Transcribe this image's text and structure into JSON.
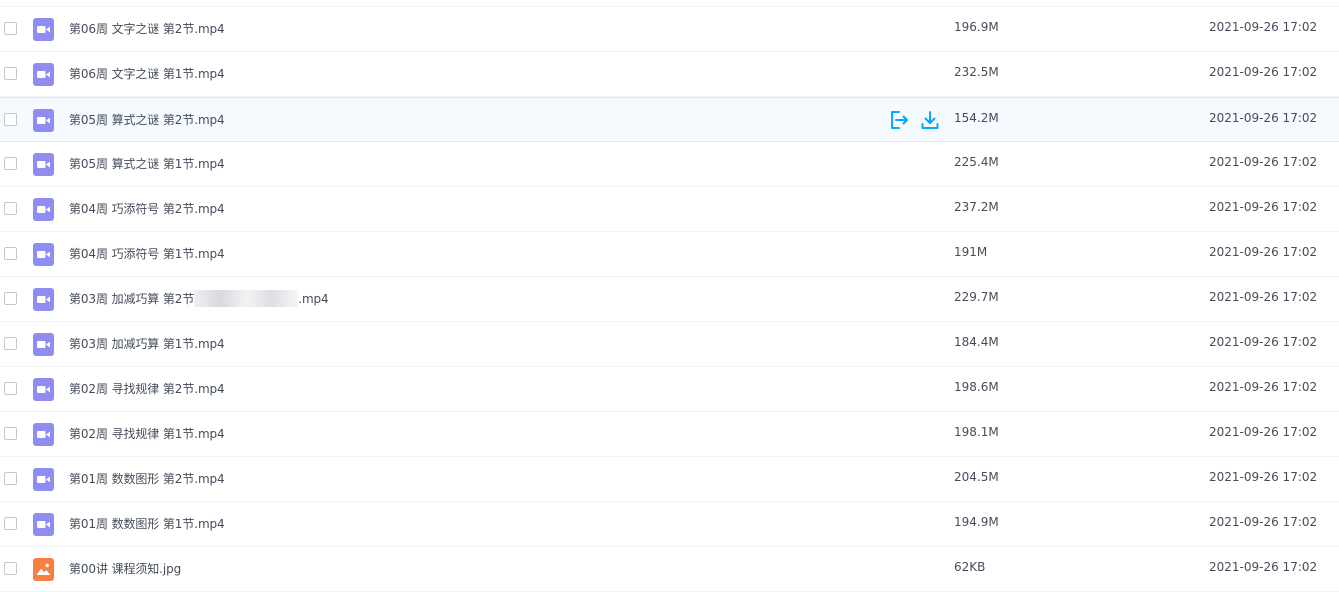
{
  "files": [
    {
      "name": "第06周 文字之谜 第2节.mp4",
      "size": "196.9M",
      "date": "2021-09-26 17:02",
      "type": "video",
      "icon": "video-file-icon"
    },
    {
      "name": "第06周 文字之谜 第1节.mp4",
      "size": "232.5M",
      "date": "2021-09-26 17:02",
      "type": "video",
      "icon": "video-file-icon"
    },
    {
      "name": "第05周 算式之谜 第2节.mp4",
      "size": "154.2M",
      "date": "2021-09-26 17:02",
      "type": "video",
      "icon": "video-file-icon",
      "hovered": true
    },
    {
      "name": "第05周 算式之谜 第1节.mp4",
      "size": "225.4M",
      "date": "2021-09-26 17:02",
      "type": "video",
      "icon": "video-file-icon"
    },
    {
      "name": "第04周 巧添符号 第2节.mp4",
      "size": "237.2M",
      "date": "2021-09-26 17:02",
      "type": "video",
      "icon": "video-file-icon"
    },
    {
      "name": "第04周 巧添符号 第1节.mp4",
      "size": "191M",
      "date": "2021-09-26 17:02",
      "type": "video",
      "icon": "video-file-icon"
    },
    {
      "name_prefix": "第03周 加减巧算 第2节",
      "name_suffix": ".mp4",
      "redacted": true,
      "size": "229.7M",
      "date": "2021-09-26 17:02",
      "type": "video",
      "icon": "video-file-icon"
    },
    {
      "name": "第03周 加减巧算 第1节.mp4",
      "size": "184.4M",
      "date": "2021-09-26 17:02",
      "type": "video",
      "icon": "video-file-icon"
    },
    {
      "name": "第02周 寻找规律 第2节.mp4",
      "size": "198.6M",
      "date": "2021-09-26 17:02",
      "type": "video",
      "icon": "video-file-icon"
    },
    {
      "name": "第02周 寻找规律 第1节.mp4",
      "size": "198.1M",
      "date": "2021-09-26 17:02",
      "type": "video",
      "icon": "video-file-icon"
    },
    {
      "name": "第01周 数数图形 第2节.mp4",
      "size": "204.5M",
      "date": "2021-09-26 17:02",
      "type": "video",
      "icon": "video-file-icon"
    },
    {
      "name": "第01周 数数图形 第1节.mp4",
      "size": "194.9M",
      "date": "2021-09-26 17:02",
      "type": "video",
      "icon": "video-file-icon"
    },
    {
      "name": "第00讲 课程须知.jpg",
      "size": "62KB",
      "date": "2021-09-26 17:02",
      "type": "image",
      "icon": "image-file-icon"
    }
  ],
  "row_actions": [
    {
      "name": "share-icon",
      "label": "share"
    },
    {
      "name": "download-icon",
      "label": "download"
    }
  ],
  "colors": {
    "video_icon": "#8f8df2",
    "image_icon": "#f77f3f",
    "action_icon": "#06a7ff",
    "hover_row": "#f5fafe",
    "text": "#454d5a"
  }
}
